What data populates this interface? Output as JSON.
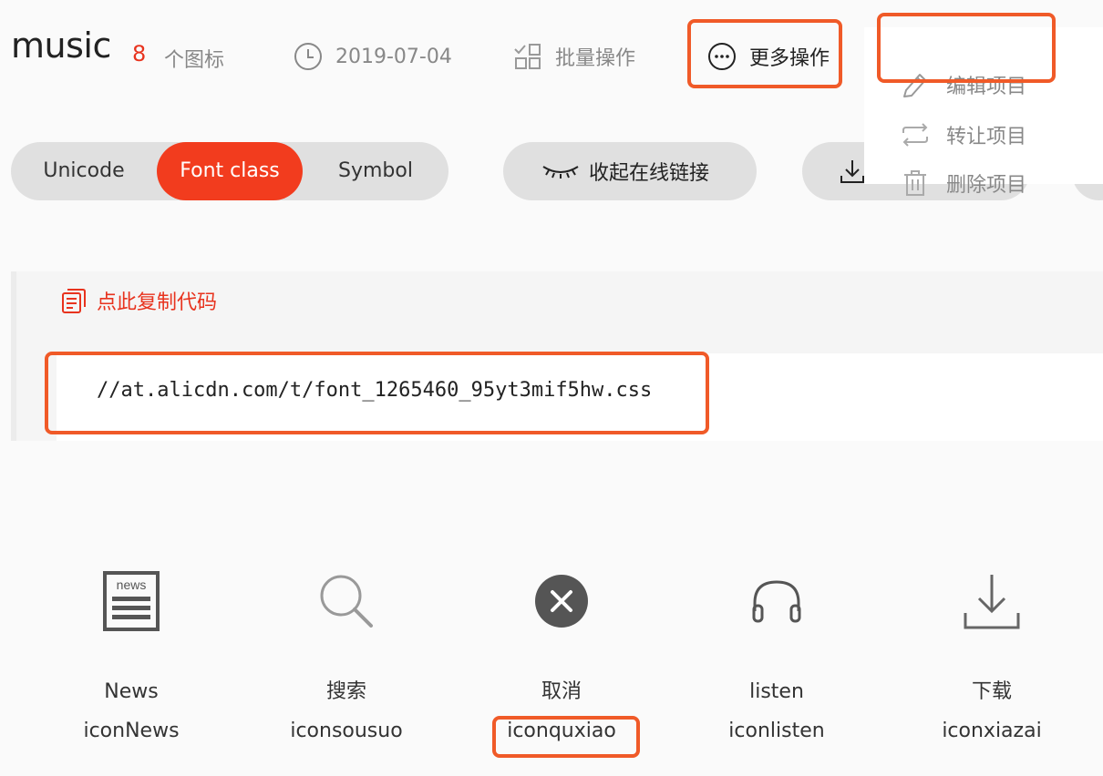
{
  "header": {
    "project_name": "music",
    "icon_count": "8",
    "icon_count_label": "个图标",
    "date": "2019-07-04",
    "batch_label": "批量操作",
    "more_label": "更多操作"
  },
  "more_menu": {
    "items": [
      {
        "label": "编辑项目",
        "icon": "pencil-icon"
      },
      {
        "label": "转让项目",
        "icon": "transfer-icon"
      },
      {
        "label": "删除项目",
        "icon": "trash-icon"
      }
    ]
  },
  "tabs": {
    "items": [
      "Unicode",
      "Font class",
      "Symbol"
    ],
    "active": "Font class"
  },
  "actions": {
    "collapse_label": "收起在线链接"
  },
  "code": {
    "copy_label": "点此复制代码",
    "url": "//at.alicdn.com/t/font_1265460_95yt3mif5hw.css"
  },
  "icons": [
    {
      "name": "News",
      "class": "iconNews",
      "icon": "news-icon"
    },
    {
      "name": "搜索",
      "class": "iconsousuo",
      "icon": "search-icon"
    },
    {
      "name": "取消",
      "class": "iconquxiao",
      "icon": "cancel-icon"
    },
    {
      "name": "listen",
      "class": "iconlisten",
      "icon": "headphones-icon"
    },
    {
      "name": "下载",
      "class": "iconxiazai",
      "icon": "download-icon"
    }
  ],
  "colors": {
    "accent": "#f23c1e",
    "highlight": "#f05a28",
    "pill_bg": "#e0e0e0",
    "muted": "#888888"
  }
}
